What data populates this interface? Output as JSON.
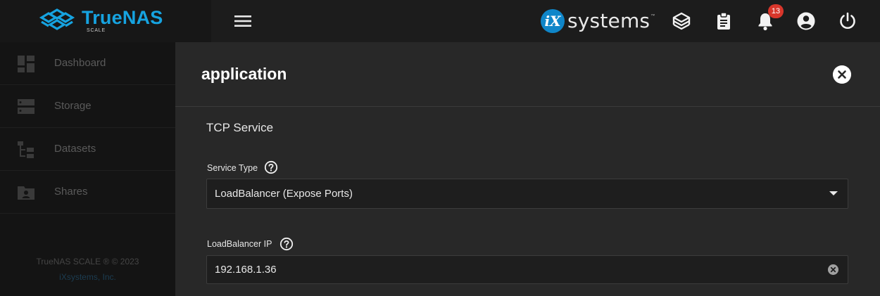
{
  "brand": {
    "name": "TrueNAS",
    "edition": "SCALE"
  },
  "header": {
    "partner_logo_mark": "iX",
    "partner_logo_text": "systems",
    "partner_logo_tm": "™",
    "notification_count": "13"
  },
  "sidebar": {
    "items": [
      {
        "label": "Dashboard",
        "icon": "dashboard-icon"
      },
      {
        "label": "Storage",
        "icon": "storage-icon"
      },
      {
        "label": "Datasets",
        "icon": "datasets-icon"
      },
      {
        "label": "Shares",
        "icon": "shares-icon"
      }
    ],
    "copyright": "TrueNAS SCALE ® © 2023",
    "company": "iXsystems, Inc."
  },
  "panel": {
    "title": "application",
    "section_title": "TCP Service",
    "service_type": {
      "label": "Service Type",
      "value": "LoadBalancer (Expose Ports)"
    },
    "loadbalancer_ip": {
      "label": "LoadBalancer IP",
      "value": "192.168.1.36"
    }
  },
  "colors": {
    "brand": "#16a3e0",
    "badge": "#d8362b",
    "ix_blue": "#0f86c9"
  }
}
